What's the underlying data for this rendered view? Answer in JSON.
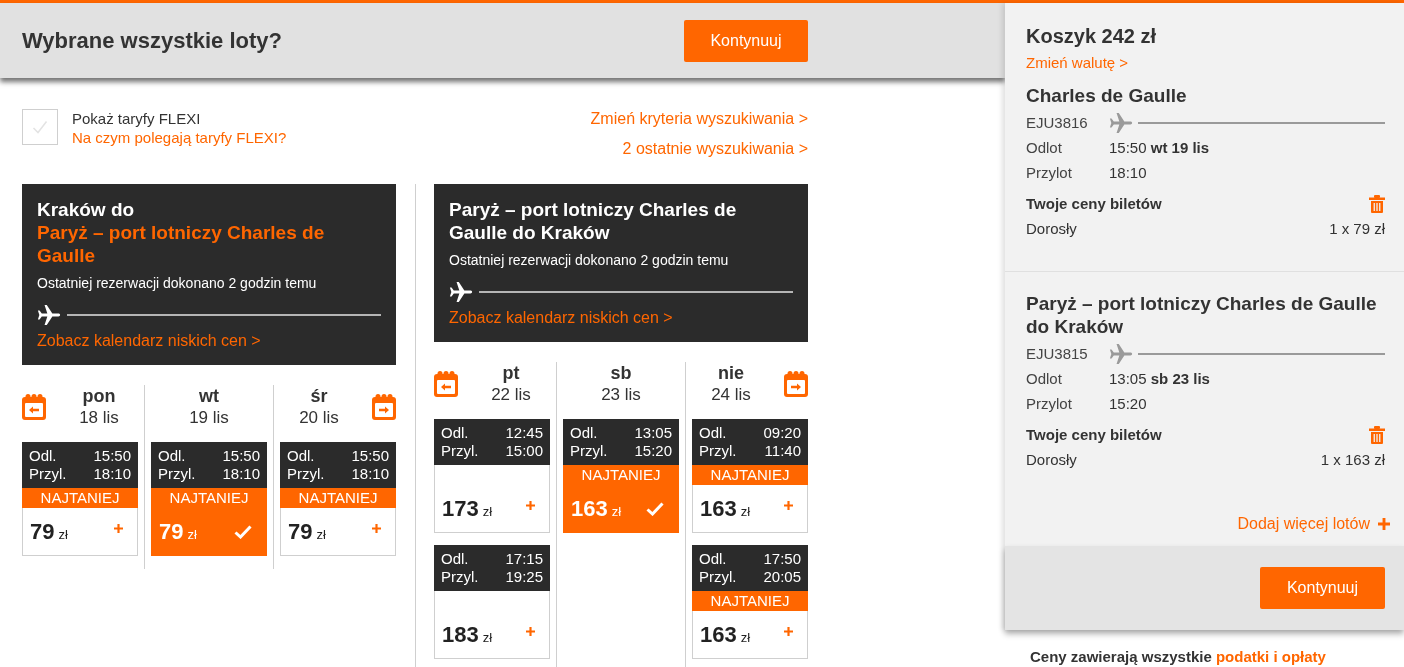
{
  "header": {
    "title": "Wybrane wszystkie loty?",
    "button": "Kontynuuj"
  },
  "flexi": {
    "checked": false,
    "label": "Pokaż taryfy FLEXI",
    "info_link": "Na czym polegają taryfy FLEXI?"
  },
  "search_links": [
    "Zmień kryteria wyszukiwania >",
    "2 ostatnie wyszukiwania >"
  ],
  "journeys": [
    {
      "title": [
        {
          "text": "Kraków do",
          "highlight": false
        },
        {
          "text": "Paryż – port lotniczy Charles de Gaulle",
          "highlight": true
        }
      ],
      "note": "Ostatniej rezerwacji dokonano 2 godzin temu",
      "calendar_link": "Zobacz kalendarz niskich cen >",
      "days": [
        {
          "day": "pon",
          "date": "18 lis",
          "flights": [
            {
              "depart_label": "Odl.",
              "depart": "15:50",
              "arrive_label": "Przyl.",
              "arrive": "18:10",
              "badge": "NAJTANIEJ",
              "price": "79",
              "currency": "zł",
              "selected": false
            }
          ]
        },
        {
          "day": "wt",
          "date": "19 lis",
          "flights": [
            {
              "depart_label": "Odl.",
              "depart": "15:50",
              "arrive_label": "Przyl.",
              "arrive": "18:10",
              "badge": "NAJTANIEJ",
              "price": "79",
              "currency": "zł",
              "selected": true
            }
          ]
        },
        {
          "day": "śr",
          "date": "20 lis",
          "flights": [
            {
              "depart_label": "Odl.",
              "depart": "15:50",
              "arrive_label": "Przyl.",
              "arrive": "18:10",
              "badge": "NAJTANIEJ",
              "price": "79",
              "currency": "zł",
              "selected": false
            }
          ]
        }
      ]
    },
    {
      "title": [
        {
          "text": "Paryż – port lotniczy Charles de Gaulle do Kraków",
          "highlight": false
        }
      ],
      "note": "Ostatniej rezerwacji dokonano 2 godzin temu",
      "calendar_link": "Zobacz kalendarz niskich cen >",
      "days": [
        {
          "day": "pt",
          "date": "22 lis",
          "flights": [
            {
              "depart_label": "Odl.",
              "depart": "12:45",
              "arrive_label": "Przyl.",
              "arrive": "15:00",
              "price": "173",
              "currency": "zł",
              "selected": false
            },
            {
              "depart_label": "Odl.",
              "depart": "17:15",
              "arrive_label": "Przyl.",
              "arrive": "19:25",
              "price": "183",
              "currency": "zł",
              "selected": false
            }
          ]
        },
        {
          "day": "sb",
          "date": "23 lis",
          "flights": [
            {
              "depart_label": "Odl.",
              "depart": "13:05",
              "arrive_label": "Przyl.",
              "arrive": "15:20",
              "badge": "NAJTANIEJ",
              "price": "163",
              "currency": "zł",
              "selected": true
            }
          ]
        },
        {
          "day": "nie",
          "date": "24 lis",
          "flights": [
            {
              "depart_label": "Odl.",
              "depart": "09:20",
              "arrive_label": "Przyl.",
              "arrive": "11:40",
              "badge": "NAJTANIEJ",
              "price": "163",
              "currency": "zł",
              "selected": false
            },
            {
              "depart_label": "Odl.",
              "depart": "17:50",
              "arrive_label": "Przyl.",
              "arrive": "20:05",
              "badge": "NAJTANIEJ",
              "price": "163",
              "currency": "zł",
              "selected": false
            }
          ]
        }
      ]
    }
  ],
  "basket": {
    "title": "Koszyk 242 zł",
    "currency_link": "Zmień walutę >",
    "items": [
      {
        "title": "Charles de Gaulle",
        "flight": "EJU3816",
        "rows": [
          {
            "label": "Odlot",
            "value": "15:50 **wt 19 lis**"
          },
          {
            "label": "Przylot",
            "value": "18:10"
          }
        ],
        "prices_heading": "Twoje ceny biletów",
        "passenger": "Dorosły",
        "amount": "1 x 79 zł"
      },
      {
        "title": "Paryż – port lotniczy Charles de Gaulle do Kraków",
        "flight": "EJU3815",
        "rows": [
          {
            "label": "Odlot",
            "value": "13:05 **sb 23 lis**"
          },
          {
            "label": "Przylot",
            "value": "15:20"
          }
        ],
        "prices_heading": "Twoje ceny biletów",
        "passenger": "Dorosły",
        "amount": "1 x 163 zł"
      }
    ],
    "add_link": "Dodaj więcej lotów",
    "button": "Kontynuuj"
  },
  "disclaimer": {
    "text": "Ceny zawierają wszystkie",
    "link": "podatki i opłaty"
  }
}
